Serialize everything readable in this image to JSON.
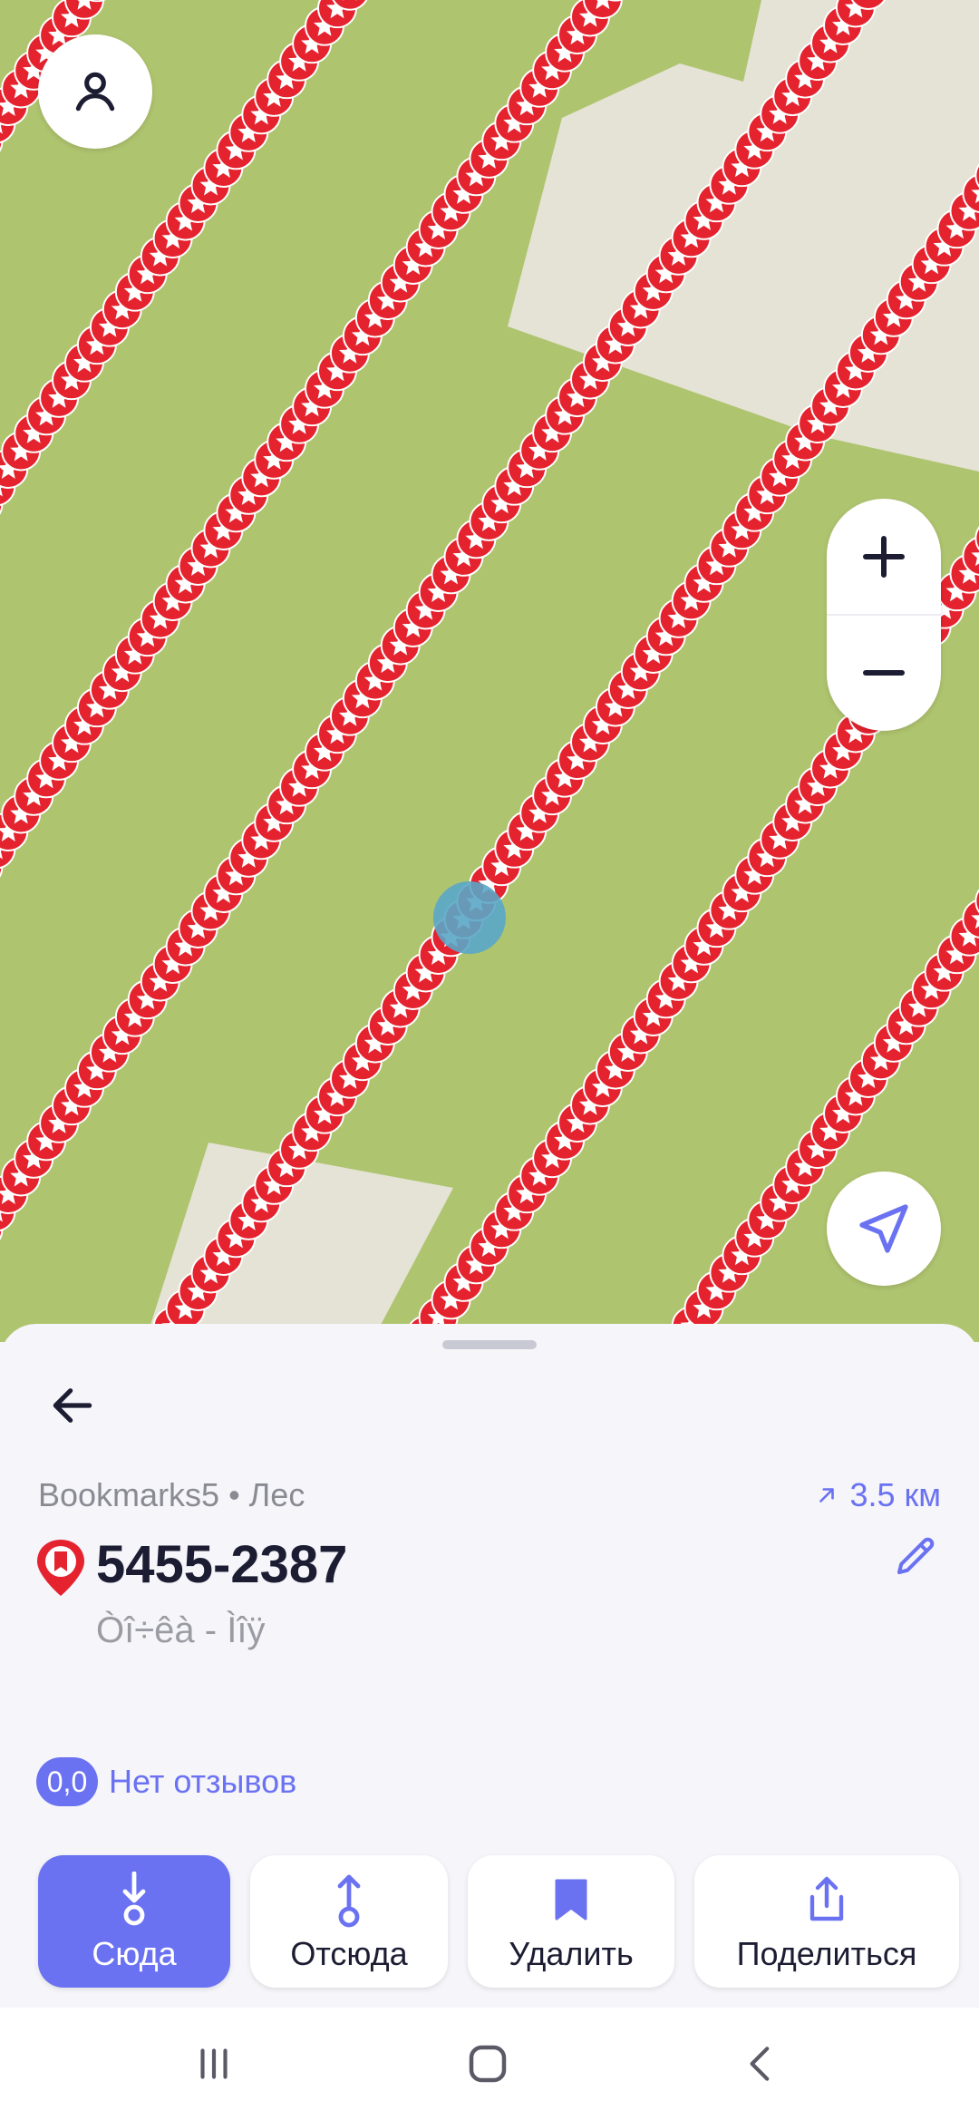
{
  "map": {
    "background_color": "#afc46f",
    "area_color": "#e4e3d5",
    "marker_color": "#e4232f",
    "accuracy_dot_color": "#5aa7c8",
    "controls": {
      "profile_icon": "person-icon",
      "zoom_in_icon": "plus-icon",
      "zoom_out_icon": "minus-icon",
      "locate_icon": "navigation-arrow-icon"
    }
  },
  "sheet": {
    "back_icon": "arrow-left-icon",
    "category": "Bookmarks5 • Лес",
    "distance": "3.5 км",
    "distance_icon": "arrow-up-right-icon",
    "title": "5455-2387",
    "title_icon": "bookmark-pin-icon",
    "subtitle": "Òî÷êà - Ìîÿ",
    "edit_icon": "pencil-icon",
    "rating": {
      "value": "0,0",
      "label": "Нет отзывов"
    },
    "actions": [
      {
        "label": "Сюда",
        "icon": "route-to-icon"
      },
      {
        "label": "Отсюда",
        "icon": "route-from-icon"
      },
      {
        "label": "Удалить",
        "icon": "bookmark-icon"
      },
      {
        "label": "Поделиться",
        "icon": "share-icon"
      }
    ]
  },
  "colors": {
    "accent": "#6b72f2",
    "text_primary": "#1c1d33",
    "text_secondary": "#8a8a93",
    "sheet_bg": "#f5f5fa"
  },
  "navbar": {
    "icons": [
      "recent-apps-icon",
      "home-icon",
      "back-icon"
    ]
  }
}
